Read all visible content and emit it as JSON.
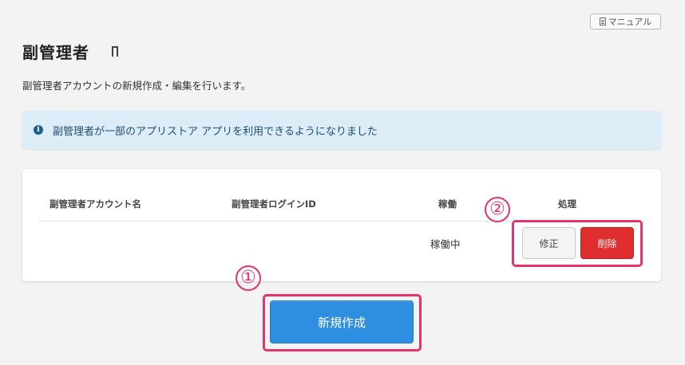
{
  "header": {
    "manual_label": "マニュアル",
    "manual_icon": "document-icon"
  },
  "page": {
    "title": "副管理者",
    "title_icon": "bookmark-icon",
    "description": "副管理者アカウントの新規作成・編集を行います。"
  },
  "info_banner": {
    "icon": "info-icon",
    "text": "副管理者が一部のアプリストア アプリを利用できるようになりました",
    "background": "#dcedf8"
  },
  "table": {
    "columns": [
      "副管理者アカウント名",
      "副管理者ログインID",
      "稼働",
      "処理"
    ],
    "rows": [
      {
        "account_name": "",
        "login_id": "",
        "status": "稼働中",
        "edit_label": "修正",
        "delete_label": "削除"
      }
    ]
  },
  "actions": {
    "create_label": "新規作成"
  },
  "annotations": {
    "marker_1": "①",
    "marker_2": "②",
    "highlight_color": "#e5336d"
  },
  "colors": {
    "primary": "#2e8fe0",
    "danger": "#e02d2d"
  }
}
